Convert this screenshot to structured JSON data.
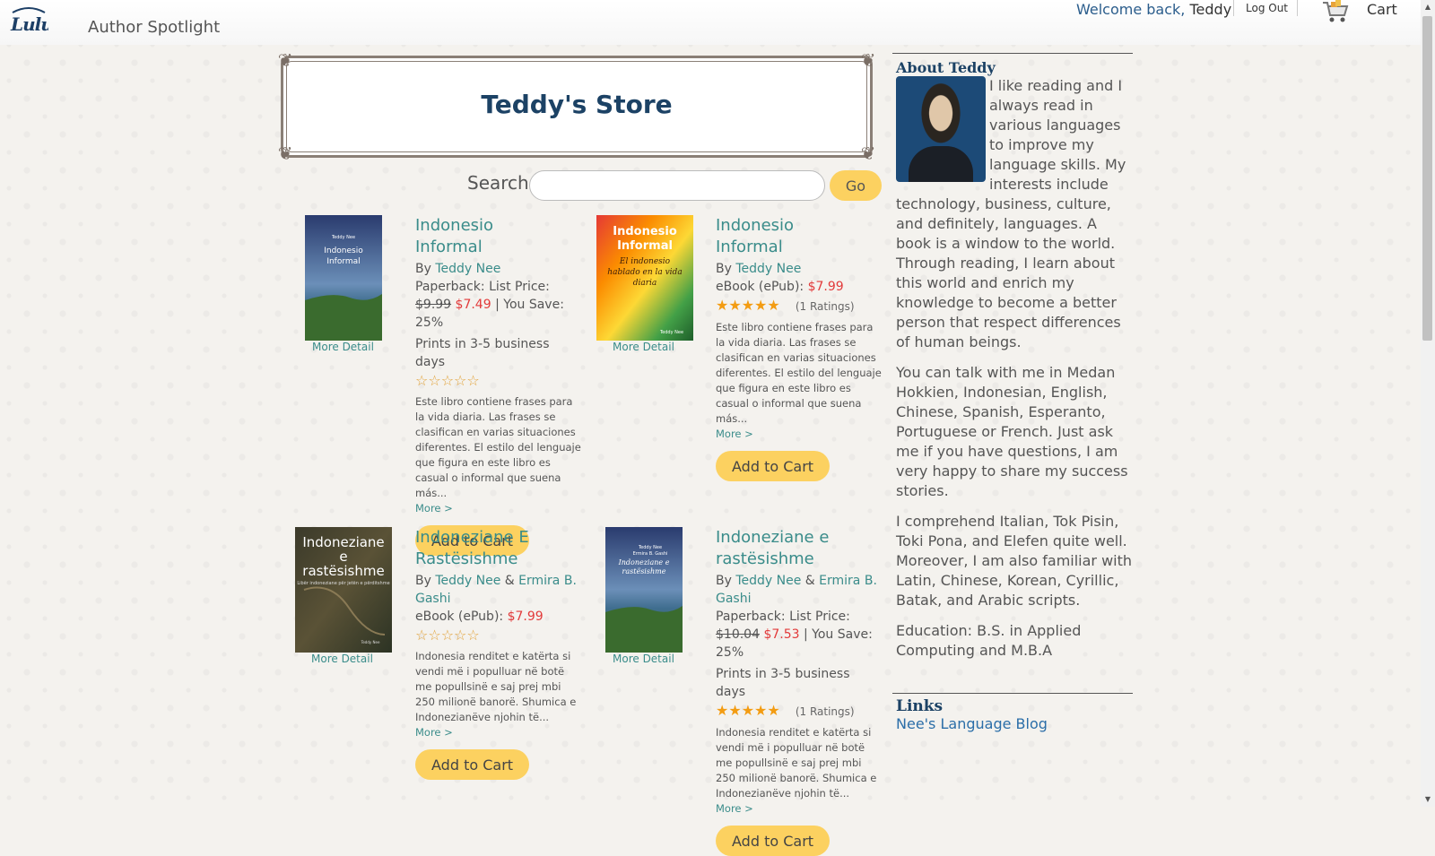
{
  "header": {
    "site_title": "Author Spotlight",
    "welcome_text": "Welcome back,",
    "user_name": "Teddy",
    "logout_label": "Log Out",
    "cart_label": "Cart",
    "logo_text": "Lulu"
  },
  "store": {
    "title": "Teddy's Store",
    "search_label": "Search",
    "search_placeholder": "",
    "go_label": "Go"
  },
  "products": [
    {
      "title_l1": "Indonesio",
      "title_l2": "Informal",
      "by": "By",
      "author1": "Teddy Nee",
      "format": "Paperback: List Price:",
      "list_price": "$9.99",
      "sale_price": "$7.49",
      "you_save": "| You Save: 25%",
      "prints": "Prints in 3-5 business days",
      "rating_stars": 0,
      "description": "Este libro contiene frases para la vida diaria. Las frases se clasifican en varias situaciones diferentes. El estilo del lenguaje que figura en este libro es casual o informal que suena más...",
      "more_label": "More >",
      "more_detail_label": "More Detail",
      "add_to_cart_label": "Add to Cart",
      "cover": {
        "title": "Indonesio Informal",
        "author": "Teddy Nee",
        "colors": [
          "#2a3b6e",
          "#6b8fb8",
          "#4e7a3a"
        ]
      }
    },
    {
      "title_l1": "Indonesio",
      "title_l2": "Informal",
      "by": "By",
      "author1": "Teddy Nee",
      "format": "eBook (ePub):",
      "sale_price": "$7.99",
      "rating_stars": 5,
      "ratings_text": "(1 Ratings)",
      "description": "Este libro contiene frases para la vida diaria. Las frases se clasifican en varias situaciones diferentes. El estilo del lenguaje que figura en este libro es casual o informal que suena más...",
      "more_label": "More >",
      "more_detail_label": "More Detail",
      "add_to_cart_label": "Add to Cart",
      "cover": {
        "title_l1": "Indonesio",
        "title_l2": "Informal",
        "subtitle": "El indonesio hablado en la vida diaria",
        "author": "Teddy Nee",
        "colors": [
          "#d32f2f",
          "#f9a825",
          "#2e7d32"
        ]
      }
    },
    {
      "title_l1": "Indoneziane E",
      "title_l2": "Rastësishme",
      "by": "By",
      "author1": "Teddy Nee",
      "amp": "&",
      "author2_l1": "Ermira B.",
      "author2_l2": "Gashi",
      "format": "eBook (ePub):",
      "sale_price": "$7.99",
      "rating_stars": 0,
      "description": "Indonesia renditet e katërta si vendi më i populluar në botë me popullsinë e saj prej mbi 250 milionë banorë. Shumica e Indonezianëve njohin të...",
      "more_label": "More >",
      "more_detail_label": "More Detail",
      "add_to_cart_label": "Add to Cart",
      "cover": {
        "title_l1": "Indoneziane",
        "title_l2": "e",
        "title_l3": "rastësishme",
        "subtitle": "Libër indoneziane për jetën e përditshme",
        "author": "Teddy Nee",
        "colors": [
          "#3b3a2a",
          "#5a5236",
          "#2c3324"
        ]
      }
    },
    {
      "title_l1": "Indoneziane e",
      "title_l2": "rastësishme",
      "by": "By",
      "author1": "Teddy Nee",
      "amp": "&",
      "author2_l1": "Ermira B.",
      "author2_l2": "Gashi",
      "format": "Paperback: List Price:",
      "list_price": "$10.04",
      "sale_price": "$7.53",
      "you_save": "| You Save:",
      "you_save_l2": "25%",
      "prints": "Prints in 3-5 business days",
      "rating_stars": 5,
      "ratings_text": "(1 Ratings)",
      "description": "Indonesia renditet e katërta si vendi më i populluar në botë me popullsinë e saj prej mbi 250 milionë banorë. Shumica e Indonezianëve njohin të...",
      "more_label": "More >",
      "more_detail_label": "More Detail",
      "add_to_cart_label": "Add to Cart",
      "cover": {
        "title_l1": "Indoneziane e",
        "title_l2": "rastësishme",
        "author": "Teddy Nee",
        "coauthor": "Ermira B. Gashi",
        "colors": [
          "#2a3b6e",
          "#6b8fb8",
          "#4e7a3a"
        ]
      }
    }
  ],
  "sidebar": {
    "about_heading": "About Teddy",
    "bio_p1": "I like reading and I always read in various languages to improve my language skills. My interests include technology, business, culture, and definitely, languages. A book is a window to the world. Through reading, I learn about this world and enrich my knowledge to become a better person that respect differences of human beings.",
    "bio_p2": "You can talk with me in Medan Hokkien, Indonesian, English, Chinese, Spanish, Esperanto, Portuguese or French. Just ask me if you have questions, I am very happy to share my success stories.",
    "bio_p3": "I comprehend Italian, Tok Pisin, Toki Pona, and Elefen quite well. Moreover, I am also familiar with Latin, Chinese, Korean, Cyrillic, Batak, and Arabic scripts.",
    "bio_p4": "Education: B.S. in Applied Computing and M.B.A",
    "links_heading": "Links",
    "links": [
      "Nee's Language Blog"
    ]
  },
  "colors": {
    "accent_button": "#fcd160",
    "link_teal": "#3a8c8a",
    "sale_red": "#e23a3a",
    "heading_blue": "#1c4265"
  },
  "icons": [
    "cart-icon",
    "lulu-logo",
    "star-icon",
    "chevron-up-icon",
    "chevron-down-icon"
  ]
}
